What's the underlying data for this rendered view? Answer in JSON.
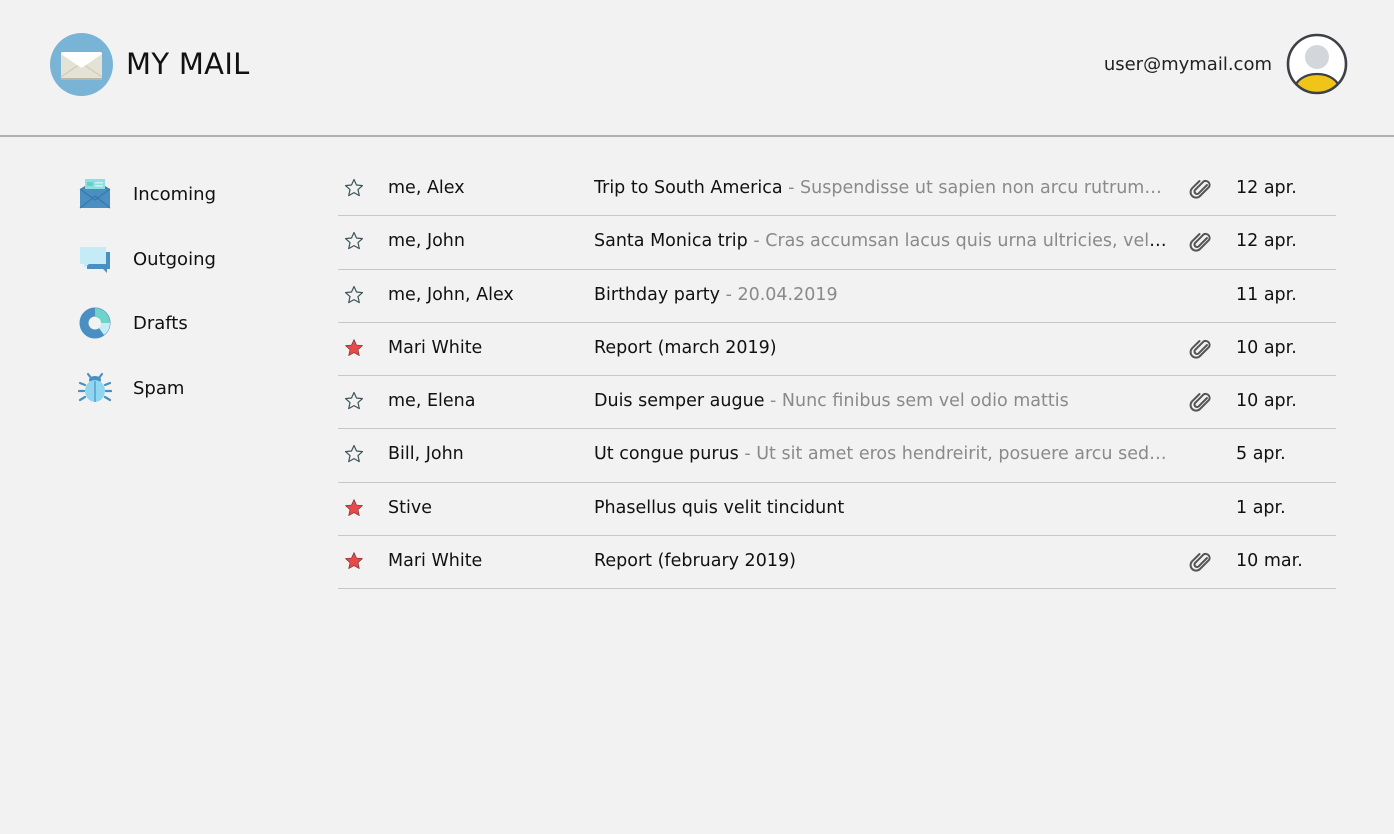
{
  "header": {
    "app_title": "MY MAIL",
    "logo_icon": "envelope-icon",
    "user_email": "user@mymail.com",
    "avatar_icon": "user-avatar-icon"
  },
  "colors": {
    "background": "#f2f2f2",
    "logo_circle": "#79b4d6",
    "star_active": "#e8494a",
    "star_inactive_outline": "#3d5459",
    "preview_text": "#8a8a8a",
    "divider": "#c8c8c8",
    "avatar_accent": "#f0c419"
  },
  "sidebar": {
    "items": [
      {
        "label": "Incoming",
        "icon": "inbox-envelope-icon"
      },
      {
        "label": "Outgoing",
        "icon": "chat-bubbles-icon"
      },
      {
        "label": "Drafts",
        "icon": "donut-chart-icon"
      },
      {
        "label": "Spam",
        "icon": "bug-icon"
      }
    ]
  },
  "emails": [
    {
      "starred": false,
      "sender": "me, Alex",
      "subject": "Trip to South America",
      "preview": " - Suspendisse ut sapien non arcu rutrum…",
      "attachment": true,
      "date": "12 apr."
    },
    {
      "starred": false,
      "sender": "me, John",
      "subject": "Santa Monica trip",
      "preview": " - Cras accumsan lacus quis urna ultricies, vel …",
      "attachment": true,
      "date": "12 apr."
    },
    {
      "starred": false,
      "sender": "me, John, Alex",
      "subject": "Birthday party",
      "preview": " - 20.04.2019",
      "attachment": false,
      "date": "11 apr."
    },
    {
      "starred": true,
      "sender": "Mari White",
      "subject": "Report (march 2019)",
      "preview": "",
      "attachment": true,
      "date": "10 apr."
    },
    {
      "starred": false,
      "sender": "me, Elena",
      "subject": "Duis semper augue",
      "preview": " - Nunc finibus sem vel odio mattis",
      "attachment": true,
      "date": "10 apr."
    },
    {
      "starred": false,
      "sender": "Bill, John",
      "subject": "Ut congue purus",
      "preview": " - Ut sit amet eros hendreirit, posuere arcu sed…",
      "attachment": false,
      "date": "5 apr."
    },
    {
      "starred": true,
      "sender": "Stive",
      "subject": "Phasellus quis velit tincidunt",
      "preview": "",
      "attachment": false,
      "date": "1 apr."
    },
    {
      "starred": true,
      "sender": "Mari White",
      "subject": "Report (february 2019)",
      "preview": "",
      "attachment": true,
      "date": "10 mar."
    }
  ]
}
